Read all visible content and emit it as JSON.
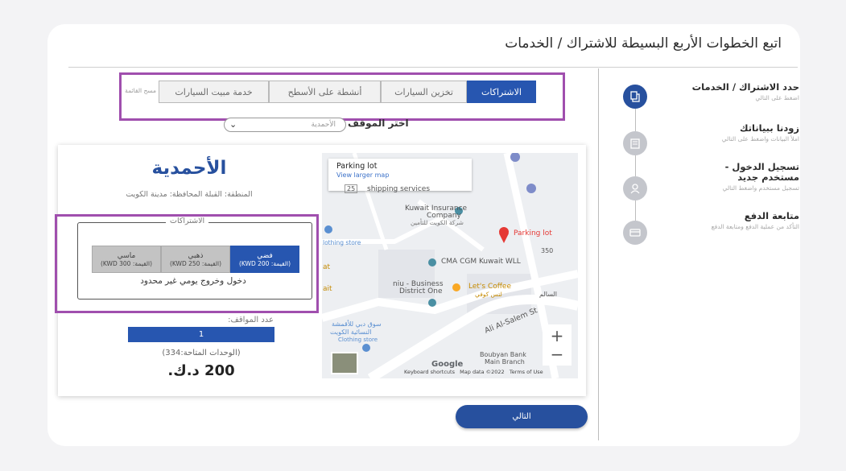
{
  "page_title": "اتبع الخطوات الأربع البسيطة للاشتراك / الخدمات",
  "steps": [
    {
      "title": "حدد الاشتراك / الخدمات",
      "subtitle": "اضغط على التالي",
      "icon": "copy-icon",
      "active": true
    },
    {
      "title": "زودنا ببياناتك",
      "subtitle": "املأ البيانات واضغط على التالي",
      "icon": "form-icon",
      "active": false
    },
    {
      "title": "تسجيل الدخول - مستخدم جديد",
      "subtitle": "تسجيل مستخدم واضغط التالي",
      "icon": "user-icon",
      "active": false
    },
    {
      "title": "متابعة الدفع",
      "subtitle": "التأكد من عملية الدفع ومتابعة الدفع",
      "icon": "card-icon",
      "active": false
    }
  ],
  "tabs": [
    {
      "label": "الاشتراكات",
      "active": true
    },
    {
      "label": "تخزين السيارات",
      "active": false
    },
    {
      "label": "أنشطة على الأسطح",
      "active": false
    },
    {
      "label": "خدمة مبيت السيارات",
      "active": false
    }
  ],
  "tab_overflow_label": "مسح القائمة",
  "location": {
    "label": "اختر الموقف",
    "selected": "الأحمدية"
  },
  "area": {
    "name": "الأحمدية",
    "subtitle": "المنطقة: القبلة المحافظة: مدينة الكويت"
  },
  "subscriptions": {
    "legend": "الاشتراكات",
    "plans": [
      {
        "name": "فضي",
        "price": "(القيمة: 200 KWD)",
        "active": true
      },
      {
        "name": "ذهبي",
        "price": "(القيمة: 250 KWD)",
        "active": false
      },
      {
        "name": "ماسي",
        "price": "(القيمة: 300 KWD)",
        "active": false
      }
    ],
    "description": "دخول وخروج يومي غير محدود"
  },
  "spots": {
    "label": "عدد المواقف:",
    "value": "1"
  },
  "available_units": "(الوحدات المتاحة:334)",
  "price": "200 د.ك.",
  "next_button": "التالي",
  "map": {
    "card_title": "Parking lot",
    "card_link": "View larger map",
    "road_badge": "25",
    "labels": {
      "shipping": "shipping services",
      "insurance_en": "Kuwait Insurance",
      "insurance_en2": "Company",
      "insurance_ar": "شركة الكويت للتأمين",
      "parking": "Parking lot",
      "clothing": "lothing store",
      "cma": "CMA CGM Kuwait WLL",
      "niu1": "niu - Business",
      "niu2": "District One",
      "coffee_en": "Let's Coffee",
      "coffee_ar": "لتس كوفي",
      "salem_ar": "السالم",
      "salem_en": "Ali Al-Salem St",
      "dubai1": "سوق دبي للأقمشة",
      "dubai2": "النسائية الكويت",
      "clothing2": "Clothing store",
      "boubyan1": "Boubyan Bank",
      "boubyan2": "Main Branch",
      "at": "at",
      "ait": "ait",
      "num350": "350"
    },
    "zoom_in": "+",
    "zoom_out": "−",
    "google": "Google",
    "shortcuts": "Keyboard shortcuts",
    "map_data": "Map data ©2022",
    "terms": "Terms of Use"
  }
}
